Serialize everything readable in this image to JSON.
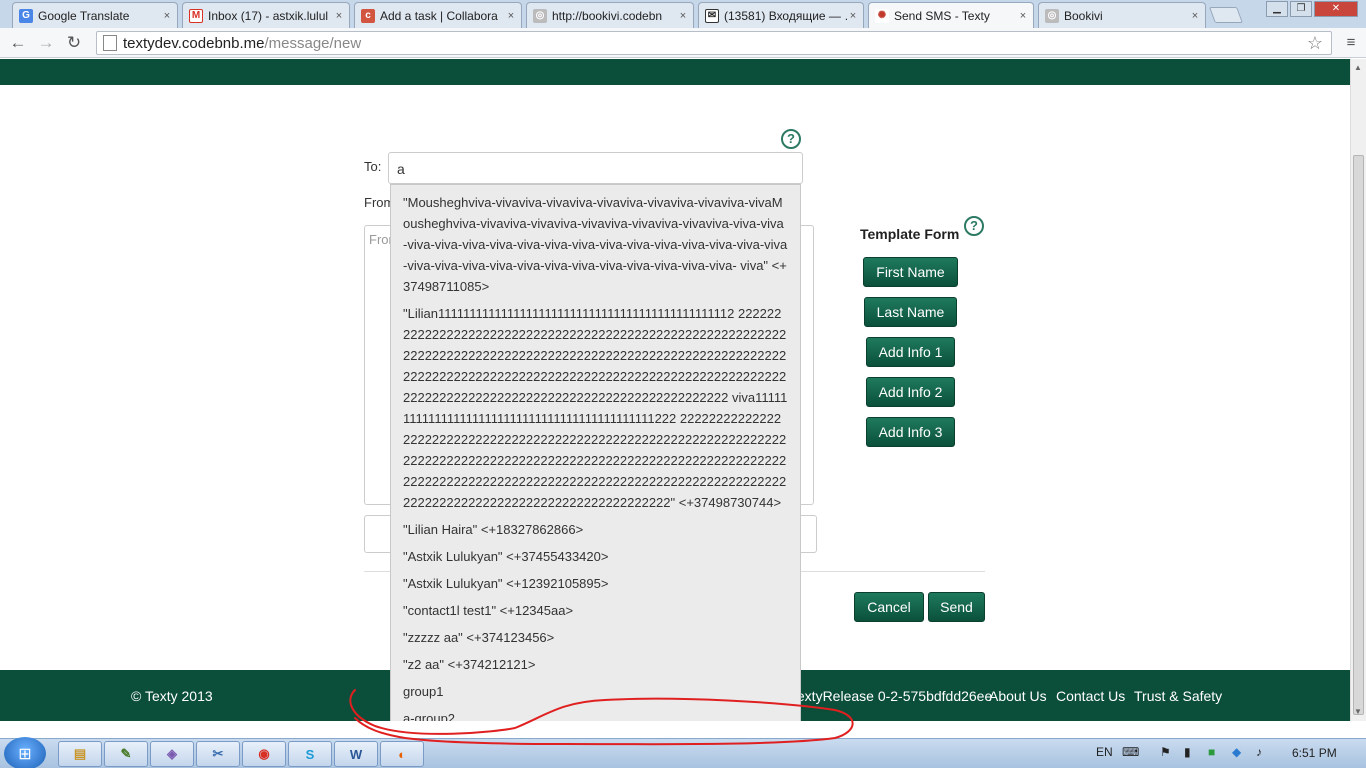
{
  "browser": {
    "tabs": [
      {
        "label": "Google Translate",
        "icon": "translate-icon"
      },
      {
        "label": "Inbox (17) - astxik.lulul",
        "icon": "gmail-icon"
      },
      {
        "label": "Add a task | Collabora",
        "icon": "collabora-icon"
      },
      {
        "label": "http://bookivi.codebn",
        "icon": "page-icon"
      },
      {
        "label": "(13581) Входящие — …",
        "icon": "mail-icon"
      },
      {
        "label": "Send SMS - Texty",
        "icon": "texty-icon"
      },
      {
        "label": "Bookivi",
        "icon": "page-icon"
      }
    ],
    "close_glyph": "×",
    "url_host": "textydev.codebnb.me",
    "url_path": "/message/new"
  },
  "form": {
    "to_label": "To:",
    "to_value": "a",
    "from_label": "From",
    "message_placeholder": "From",
    "help_glyph": "?"
  },
  "template": {
    "title": "Template Form",
    "buttons": [
      "First Name",
      "Last Name",
      "Add Info 1",
      "Add Info 2",
      "Add Info 3"
    ]
  },
  "actions": {
    "cancel": "Cancel",
    "send": "Send"
  },
  "autocomplete": [
    "\"Mousheghviva-vivaviva-vivaviva-vivaviva-vivaviva-vivaviva-vivaMousheghviva-vivaviva-vivaviva-vivaviva-vivaviva-vivaviva-viva-viva-viva-viva-viva-viva-viva-viva-viva-viva-viva-viva-viva-viva-viva-viva-viva-viva-viva-viva-viva-viva-viva-viva-viva-viva-viva-viva- viva\" <+37498711085>",
    "\"Lilian11111111111111111111111111111111111111111111112 222222222222222222222222222222222222222222222222222222222222222222222222222222222222222222222222222222222222222222222222222222222222222222222222222222222222222222222222222222222222222222222222222222222222222222 viva111111111111111111111111111111111111111111111222 222222222222222222222222222222222222222222222222222222222222222222222222222222222222222222222222222222222222222222222222222222222222222222222222222222222222222222222222222222222222222222222222222222222222222222\" <+37498730744>",
    "\"Lilian Haira\" <+18327862866>",
    "\"Astxik Lulukyan\" <+37455433420>",
    "\"Astxik Lulukyan\" <+12392105895>",
    "\"contact1l test1\" <+12345aa>",
    "\"zzzzz aa\" <+374123456>",
    "\"z2 aa\" <+374212121>",
    "group1",
    "a-group2"
  ],
  "footer": {
    "copyright": "© Texty 2013",
    "release": "textyRelease 0-2-575bdfdd26ee",
    "links": [
      "About Us",
      "Contact Us",
      "Trust & Safety"
    ]
  },
  "taskbar": {
    "language": "EN",
    "time": "6:51 PM",
    "start_icon": "windows-start-icon",
    "apps": [
      "explorer-icon",
      "notepad-icon",
      "app-icon",
      "tool-icon",
      "chrome-icon",
      "skype-icon",
      "word-icon",
      "firefox-icon"
    ]
  },
  "annotation": {
    "color": "#e02020"
  }
}
